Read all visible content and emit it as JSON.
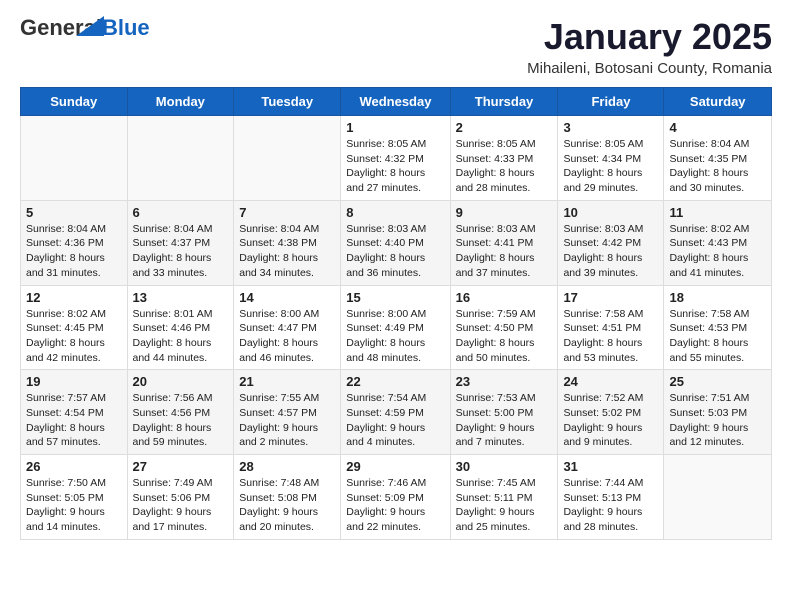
{
  "logo": {
    "general": "General",
    "blue": "Blue"
  },
  "title": "January 2025",
  "location": "Mihaileni, Botosani County, Romania",
  "days_of_week": [
    "Sunday",
    "Monday",
    "Tuesday",
    "Wednesday",
    "Thursday",
    "Friday",
    "Saturday"
  ],
  "weeks": [
    [
      {
        "day": "",
        "info": ""
      },
      {
        "day": "",
        "info": ""
      },
      {
        "day": "",
        "info": ""
      },
      {
        "day": "1",
        "info": "Sunrise: 8:05 AM\nSunset: 4:32 PM\nDaylight: 8 hours and 27 minutes."
      },
      {
        "day": "2",
        "info": "Sunrise: 8:05 AM\nSunset: 4:33 PM\nDaylight: 8 hours and 28 minutes."
      },
      {
        "day": "3",
        "info": "Sunrise: 8:05 AM\nSunset: 4:34 PM\nDaylight: 8 hours and 29 minutes."
      },
      {
        "day": "4",
        "info": "Sunrise: 8:04 AM\nSunset: 4:35 PM\nDaylight: 8 hours and 30 minutes."
      }
    ],
    [
      {
        "day": "5",
        "info": "Sunrise: 8:04 AM\nSunset: 4:36 PM\nDaylight: 8 hours and 31 minutes."
      },
      {
        "day": "6",
        "info": "Sunrise: 8:04 AM\nSunset: 4:37 PM\nDaylight: 8 hours and 33 minutes."
      },
      {
        "day": "7",
        "info": "Sunrise: 8:04 AM\nSunset: 4:38 PM\nDaylight: 8 hours and 34 minutes."
      },
      {
        "day": "8",
        "info": "Sunrise: 8:03 AM\nSunset: 4:40 PM\nDaylight: 8 hours and 36 minutes."
      },
      {
        "day": "9",
        "info": "Sunrise: 8:03 AM\nSunset: 4:41 PM\nDaylight: 8 hours and 37 minutes."
      },
      {
        "day": "10",
        "info": "Sunrise: 8:03 AM\nSunset: 4:42 PM\nDaylight: 8 hours and 39 minutes."
      },
      {
        "day": "11",
        "info": "Sunrise: 8:02 AM\nSunset: 4:43 PM\nDaylight: 8 hours and 41 minutes."
      }
    ],
    [
      {
        "day": "12",
        "info": "Sunrise: 8:02 AM\nSunset: 4:45 PM\nDaylight: 8 hours and 42 minutes."
      },
      {
        "day": "13",
        "info": "Sunrise: 8:01 AM\nSunset: 4:46 PM\nDaylight: 8 hours and 44 minutes."
      },
      {
        "day": "14",
        "info": "Sunrise: 8:00 AM\nSunset: 4:47 PM\nDaylight: 8 hours and 46 minutes."
      },
      {
        "day": "15",
        "info": "Sunrise: 8:00 AM\nSunset: 4:49 PM\nDaylight: 8 hours and 48 minutes."
      },
      {
        "day": "16",
        "info": "Sunrise: 7:59 AM\nSunset: 4:50 PM\nDaylight: 8 hours and 50 minutes."
      },
      {
        "day": "17",
        "info": "Sunrise: 7:58 AM\nSunset: 4:51 PM\nDaylight: 8 hours and 53 minutes."
      },
      {
        "day": "18",
        "info": "Sunrise: 7:58 AM\nSunset: 4:53 PM\nDaylight: 8 hours and 55 minutes."
      }
    ],
    [
      {
        "day": "19",
        "info": "Sunrise: 7:57 AM\nSunset: 4:54 PM\nDaylight: 8 hours and 57 minutes."
      },
      {
        "day": "20",
        "info": "Sunrise: 7:56 AM\nSunset: 4:56 PM\nDaylight: 8 hours and 59 minutes."
      },
      {
        "day": "21",
        "info": "Sunrise: 7:55 AM\nSunset: 4:57 PM\nDaylight: 9 hours and 2 minutes."
      },
      {
        "day": "22",
        "info": "Sunrise: 7:54 AM\nSunset: 4:59 PM\nDaylight: 9 hours and 4 minutes."
      },
      {
        "day": "23",
        "info": "Sunrise: 7:53 AM\nSunset: 5:00 PM\nDaylight: 9 hours and 7 minutes."
      },
      {
        "day": "24",
        "info": "Sunrise: 7:52 AM\nSunset: 5:02 PM\nDaylight: 9 hours and 9 minutes."
      },
      {
        "day": "25",
        "info": "Sunrise: 7:51 AM\nSunset: 5:03 PM\nDaylight: 9 hours and 12 minutes."
      }
    ],
    [
      {
        "day": "26",
        "info": "Sunrise: 7:50 AM\nSunset: 5:05 PM\nDaylight: 9 hours and 14 minutes."
      },
      {
        "day": "27",
        "info": "Sunrise: 7:49 AM\nSunset: 5:06 PM\nDaylight: 9 hours and 17 minutes."
      },
      {
        "day": "28",
        "info": "Sunrise: 7:48 AM\nSunset: 5:08 PM\nDaylight: 9 hours and 20 minutes."
      },
      {
        "day": "29",
        "info": "Sunrise: 7:46 AM\nSunset: 5:09 PM\nDaylight: 9 hours and 22 minutes."
      },
      {
        "day": "30",
        "info": "Sunrise: 7:45 AM\nSunset: 5:11 PM\nDaylight: 9 hours and 25 minutes."
      },
      {
        "day": "31",
        "info": "Sunrise: 7:44 AM\nSunset: 5:13 PM\nDaylight: 9 hours and 28 minutes."
      },
      {
        "day": "",
        "info": ""
      }
    ]
  ]
}
